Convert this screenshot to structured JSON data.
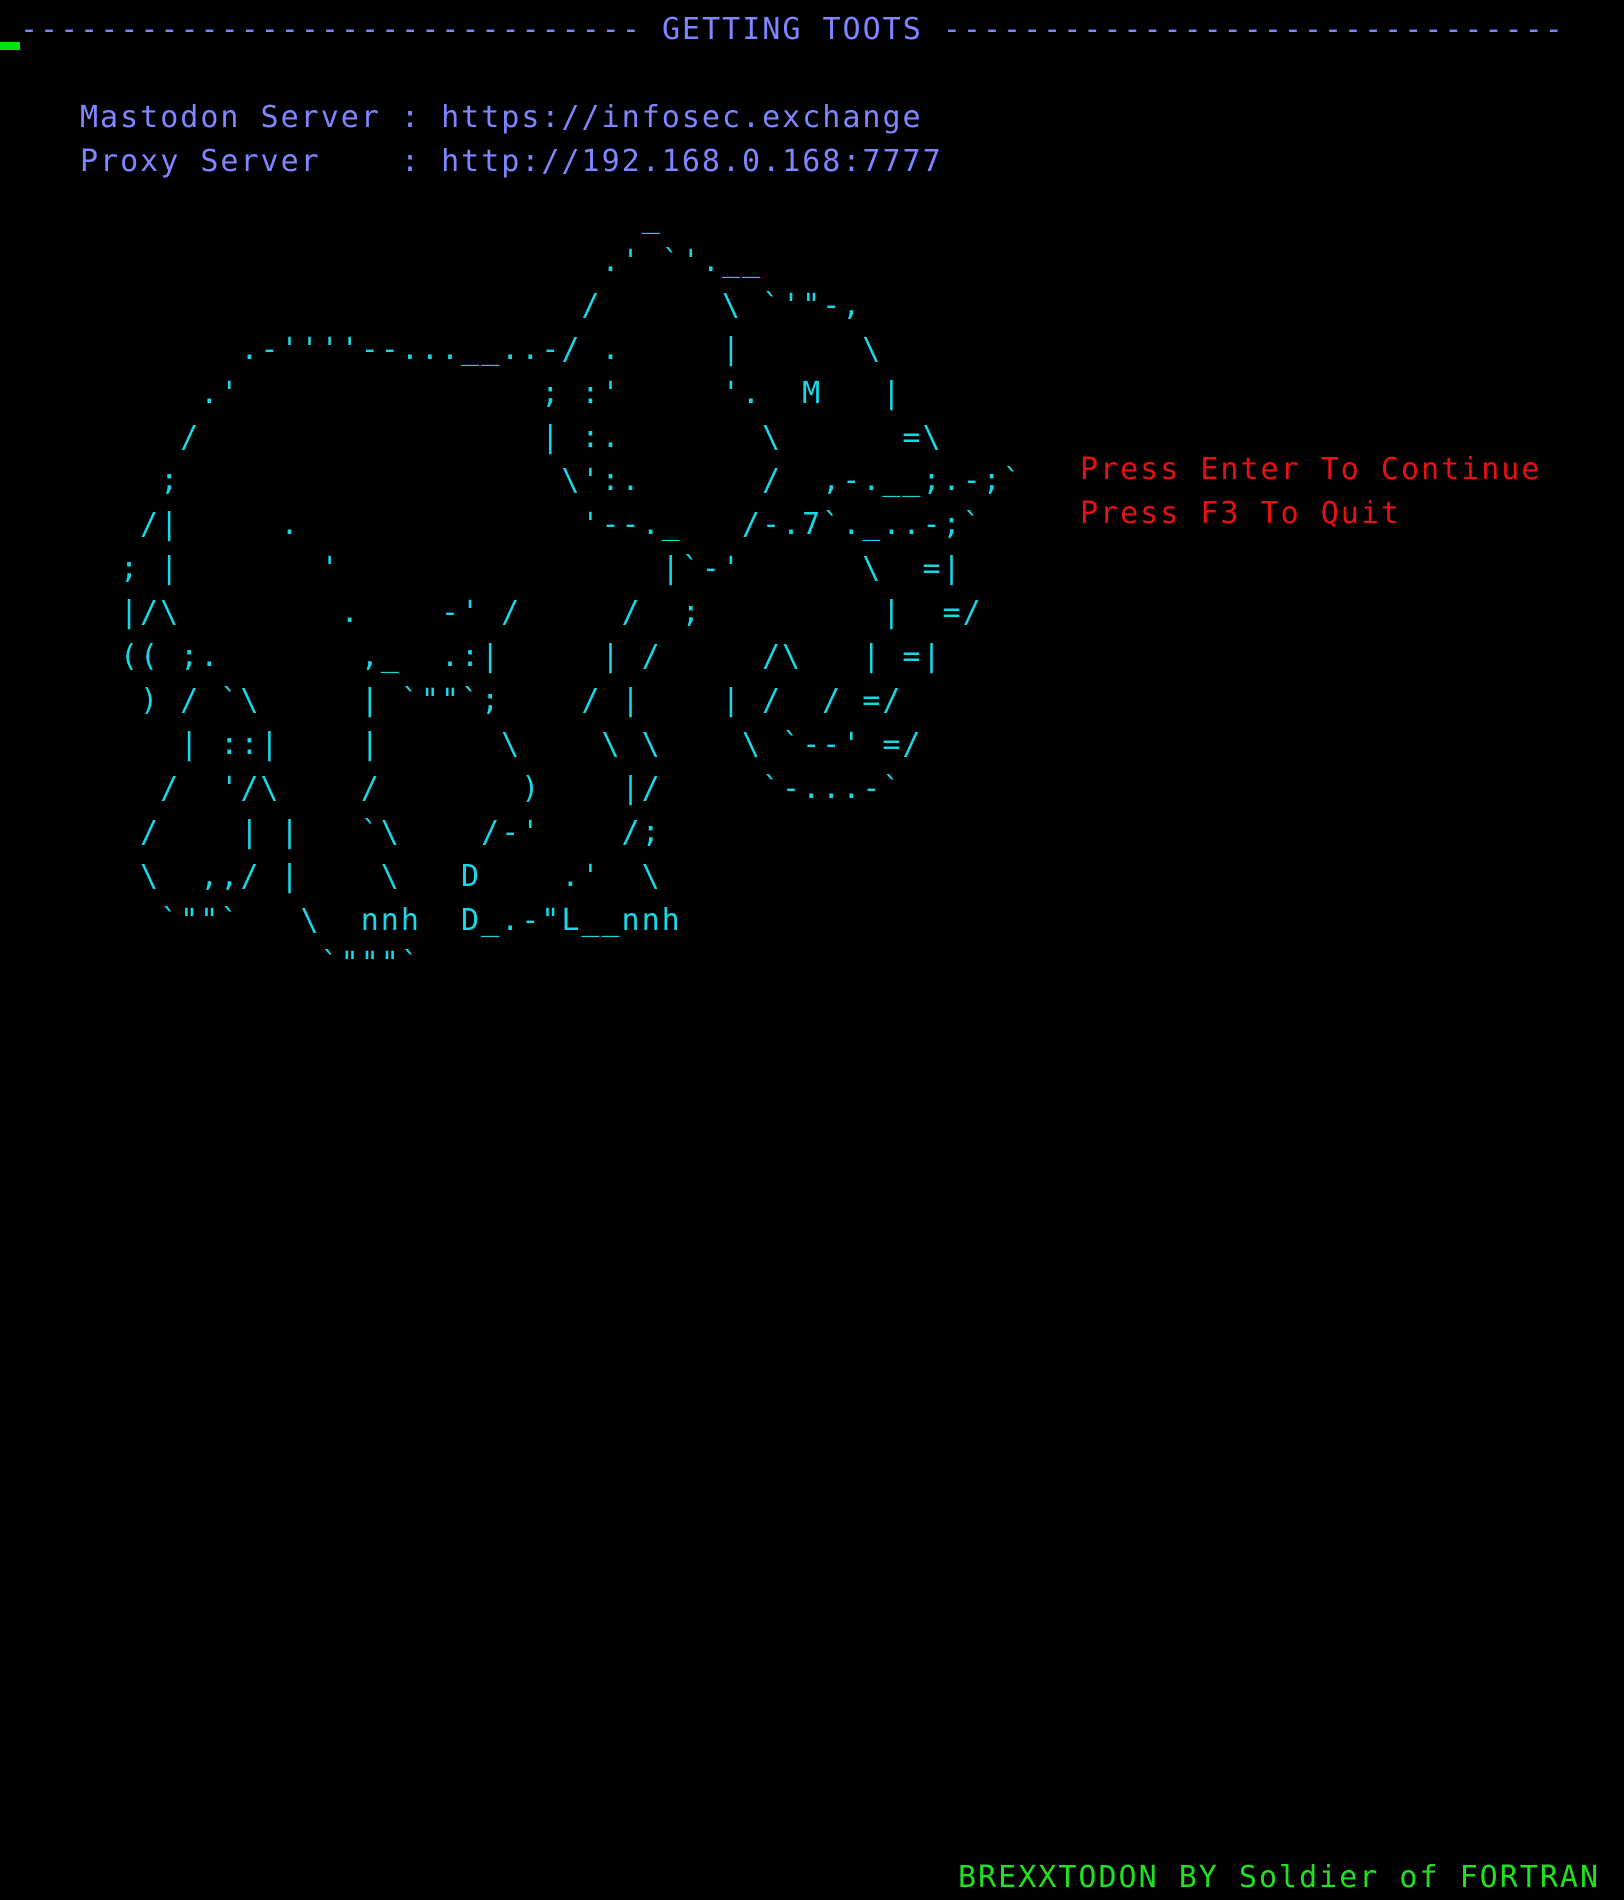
{
  "screen": {
    "title_line": "------------------------------- GETTING TOOTS -------------------------------",
    "server_line": "Mastodon Server : https://infosec.exchange",
    "proxy_line": "Proxy Server    : http://192.168.0.168:7777",
    "prompt_continue": "Press Enter To Continue",
    "prompt_quit": "Press F3 To Quit",
    "footer": "BREXXTODON BY Soldier of FORTRAN",
    "ascii_art": "                          _\n                        .' `'.__\n                       /      \\ `'\"-,\n      .-''''--...__..-/ .     |      \\\n    .'               ; :'     '.  M   |\n   /                 | :.       \\      =\\\n  ;                   \\':.      /  ,-.__;.-;`\n /|     .              '--._   /-.7`._..-;`\n; |       '                |`-'      \\  =|\n|/\\        .    -' /     /  ;         |  =/\n(( ;.       ,_  .:|     | /     /\\   | =|\n ) / `\\     | `\"\"`;    / |    | /  / =/\n   | ::|    |      \\    \\ \\    \\ `--' =/\n  /  '/\\    /       )    |/     `-...-`\n /    | |   `\\    /-'    /;\n \\  ,,/ |    \\   D    .'  \\\n  `\"\"`   \\  nnh  D_.-\"L__nnh\n          `\"\"\"`"
  },
  "colors": {
    "background": "#000000",
    "info_text": "#7f86ff",
    "ascii_art": "#18d8e8",
    "prompt_text": "#e81010",
    "footer_text": "#20e020",
    "cursor": "#00e600"
  }
}
